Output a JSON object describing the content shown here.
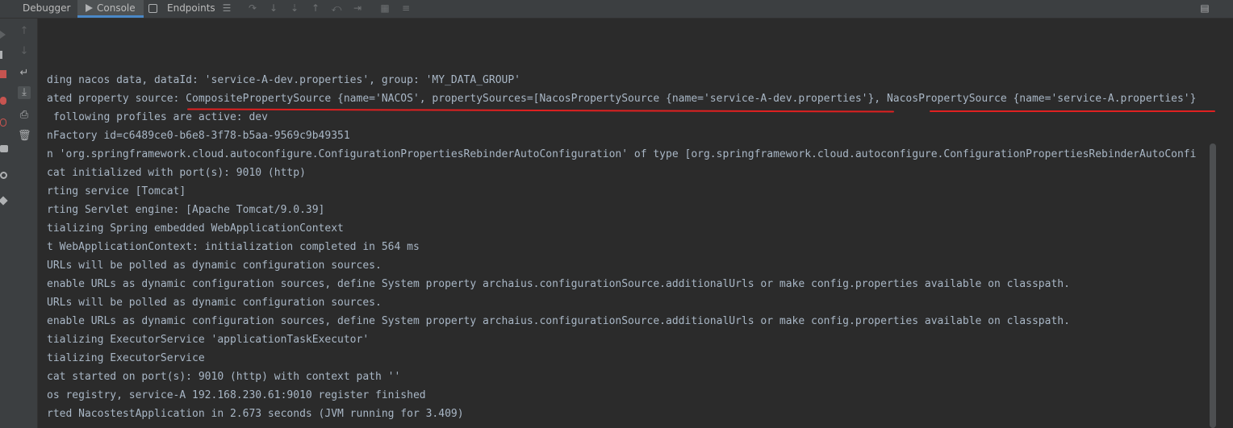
{
  "tabs": {
    "debugger": "Debugger",
    "console": "Console",
    "endpoints": "Endpoints"
  },
  "icons": {
    "toolbar": [
      "menu-icon",
      "step-over-icon",
      "step-into-icon",
      "force-step-into-icon",
      "step-out-icon",
      "drop-frame-icon",
      "run-to-cursor-icon",
      "evaluate-icon",
      "layout-icon"
    ],
    "sidebar": [
      "up-arrow-icon",
      "down-arrow-icon",
      "soft-wrap-icon",
      "scroll-to-end-icon",
      "print-icon",
      "trash-icon"
    ]
  },
  "console": {
    "lines": [
      "ding nacos data, dataId: 'service-A-dev.properties', group: 'MY_DATA_GROUP'",
      "ated property source: CompositePropertySource {name='NACOS', propertySources=[NacosPropertySource {name='service-A-dev.properties'}, NacosPropertySource {name='service-A.properties'}",
      " following profiles are active: dev",
      "nFactory id=c6489ce0-b6e8-3f78-b5aa-9569c9b49351",
      "n 'org.springframework.cloud.autoconfigure.ConfigurationPropertiesRebinderAutoConfiguration' of type [org.springframework.cloud.autoconfigure.ConfigurationPropertiesRebinderAutoConfi",
      "cat initialized with port(s): 9010 (http)",
      "rting service [Tomcat]",
      "rting Servlet engine: [Apache Tomcat/9.0.39]",
      "tializing Spring embedded WebApplicationContext",
      "t WebApplicationContext: initialization completed in 564 ms",
      "URLs will be polled as dynamic configuration sources.",
      "enable URLs as dynamic configuration sources, define System property archaius.configurationSource.additionalUrls or make config.properties available on classpath.",
      "URLs will be polled as dynamic configuration sources.",
      "enable URLs as dynamic configuration sources, define System property archaius.configurationSource.additionalUrls or make config.properties available on classpath.",
      "tializing ExecutorService 'applicationTaskExecutor'",
      "tializing ExecutorService",
      "cat started on port(s): 9010 (http) with context path ''",
      "os registry, service-A 192.168.230.61:9010 register finished",
      "rted NacostestApplication in 2.673 seconds (JVM running for 3.409)"
    ]
  },
  "colors": {
    "background": "#2b2b2b",
    "text": "#a9b7c6",
    "annotation": "#e02020",
    "accent": "#4a88c7"
  }
}
